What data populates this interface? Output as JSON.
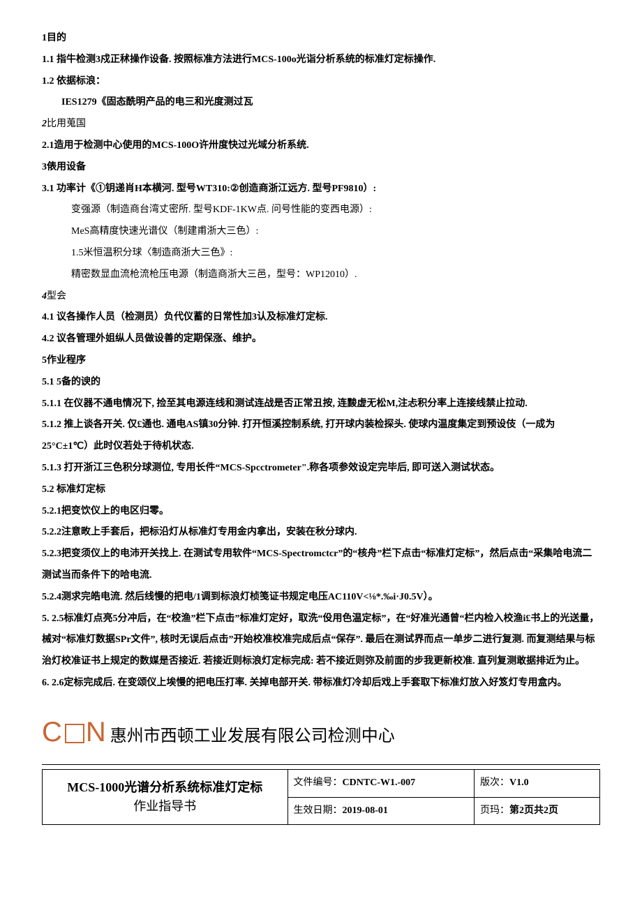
{
  "s1": {
    "head": "1目的",
    "p11": "1.1   指牛检测3戍正秫操作设备. 按照标准方法进行MCS-100o光诣分析系统的标准灯定标操作.",
    "p12": "1.2   依据标浪：",
    "p12a": "IES1279《固态酰明产品的电三和光度测过瓦"
  },
  "s2": {
    "head_num": "2",
    "head_txt": "比用蒐国",
    "p21": "2.1造用于检测中心使用的MCS-100O许卅度快过光域分析系统."
  },
  "s3": {
    "head": "3俵用设备",
    "p31": "3.1   功率计《①钥递肖H本横河. 型号WT310:②创造商浙江远方. 型号PF9810）:",
    "p31a": "变强源（制造商台湾丈密所. 型号KDF-1KW点. 问号性能的变西电源）:",
    "p31b": "MeS高精度快速光谱仪（制建甫浙大三色）:",
    "p31c": "1.5米恒温积分球〈制造商浙大三色》:",
    "p31d": "精密数显血流枪流枪压电源（制造商浙大三邑，型号：WP12010）."
  },
  "s4": {
    "head_num": "4",
    "head_txt": "型会",
    "p41": "4.1   议各操作人员（检测员）负代仪蓄的日常性加3认及标准灯定标.",
    "p42": "4.2   议各管理外姐纵人员做设善的定期保涨、维护。"
  },
  "s5": {
    "head": "5作业程序",
    "p51": "5.1   5备的谀的",
    "p511": "5.1.1    在仪器不通电情况下, 捡至其电源连线和测试连战是否正常丑按, 连黢虚无松M,注忐积分率上连接线禁止拉动.",
    "p512": "5.1.2    推上谈各开关. 仅£通也. 通电AS镇30分钟. 打开恒溪控制系统, 打开球内装检探头. 使球内温度集定到预设伎（一成为25°C±1℃）此时仪若处于待机状态.",
    "p513": "5.1.3    打开浙江三色积分球测位, 专用长件“MCS-Spcctrometer\".称各项参效设定完毕后, 即可送入测试状态。",
    "p52": "5.2   标准灯定标",
    "p521": "5.2.1把变饮仪上的电区归零。",
    "p522": "5.2.2注意畋上手套后，把标沿灯从标准灯专用金内拿出，安装在秋分球内.",
    "p523": "5.2.3把变须仪上的电沛开关找上. 在测试专用软件“MCS-Spectromctcr”的“核舟”栏下点击“标准灯定标”，然后点击“采集哈电流二测试当而条件下的哈电流.",
    "p524": "5.2.4测求完皓电流. 然后线慢的把电/1调到标浪灯桢笺证书规定电压AC110V<⅛*.‰i·J0.5V）。",
    "p525": "5.  2.5标准灯点亮5分冲后，在“校渔”栏下点击”标准灯定好，取洗“伇用色温定标”，在“好准光通曾“栏内检入校渔i£书上的光送量，械对“标准灯数据SPr文件”, 核时无误后点击”开始校准校准完成后点“保存”. 最后在测试界而点一单步二进行复测. 而复测结果与标治灯校准证书上规定的数媒是否接近. 若接近则标浪灯定标完成: 若不接近则弥及前面的步我更新校准. 直列复测敢据排近为止。",
    "p526": "6.  2.6定标完成后. 在变颂仪上埃慢的把电压打率. 关掉电部开关. 带标准灯冷却后戏上手套取下标准灯放入好笈灯专用盒内。"
  },
  "footer": {
    "company": "惠州市西顿工业发展有限公司检测中心",
    "doc_title_l1": "MCS-1000光谱分析系统标准灯定标",
    "doc_title_l2": "作业指导书",
    "doc_no_label": "文件编号：",
    "doc_no": "CDNTC-W1.-007",
    "ver_label": "版次：",
    "ver": "V1.0",
    "date_label": "生效日期：",
    "date": "2019-08-01",
    "page_label": "页玛：",
    "page": "第2页共2页"
  }
}
